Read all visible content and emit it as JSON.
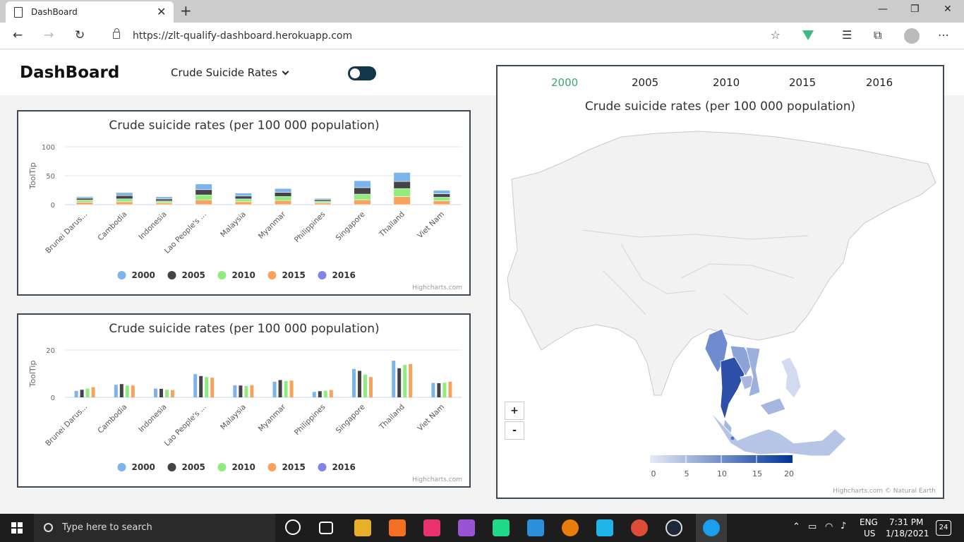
{
  "browser": {
    "tab_title": "DashBoard",
    "url": "https://zlt-qualify-dashboard.herokuapp.com"
  },
  "header": {
    "brand": "DashBoard",
    "dropdown_label": "Crude Suicide Rates"
  },
  "chart_data": [
    {
      "type": "bar",
      "stacked": true,
      "title": "Crude suicide rates (per 100 000 population)",
      "ylabel": "ToolTip",
      "ylim": [
        0,
        100
      ],
      "yticks": [
        0,
        50,
        100
      ],
      "categories": [
        "Brunei Darus...",
        "Cambodia",
        "Indonesia",
        "Lao People's ...",
        "Malaysia",
        "Myanmar",
        "Philippines",
        "Singapore",
        "Thailand",
        "Viet Nam"
      ],
      "series": [
        {
          "name": "2000",
          "color": "#7cb5ec",
          "values": [
            2.7,
            5.3,
            3.7,
            9.8,
            5.1,
            6.6,
            2.3,
            12.0,
            15.5,
            6.1
          ]
        },
        {
          "name": "2005",
          "color": "#434348",
          "values": [
            3.2,
            5.6,
            3.6,
            9.0,
            5.0,
            7.3,
            2.6,
            11.2,
            12.3,
            6.0
          ]
        },
        {
          "name": "2010",
          "color": "#90ed7d",
          "values": [
            3.7,
            5.0,
            3.2,
            8.6,
            4.8,
            6.9,
            2.8,
            9.6,
            13.7,
            6.2
          ]
        },
        {
          "name": "2015",
          "color": "#f7a35c",
          "values": [
            4.3,
            5.0,
            3.1,
            8.3,
            5.1,
            7.1,
            3.1,
            8.6,
            14.1,
            6.6
          ]
        },
        {
          "name": "2016",
          "color": "#8085e9",
          "values": [
            0,
            0,
            0,
            0,
            0,
            0,
            0,
            0,
            0,
            0
          ]
        }
      ],
      "legend_position": "bottom",
      "credit": "Highcharts.com"
    },
    {
      "type": "bar",
      "stacked": false,
      "title": "Crude suicide rates (per 100 000 population)",
      "ylabel": "ToolTip",
      "ylim": [
        0,
        20
      ],
      "yticks": [
        0,
        20
      ],
      "categories": [
        "Brunei Darus...",
        "Cambodia",
        "Indonesia",
        "Lao People's ...",
        "Malaysia",
        "Myanmar",
        "Philippines",
        "Singapore",
        "Thailand",
        "Viet Nam"
      ],
      "series": [
        {
          "name": "2000",
          "color": "#7cb5ec",
          "values": [
            2.7,
            5.3,
            3.7,
            9.8,
            5.1,
            6.6,
            2.3,
            12.0,
            15.5,
            6.1
          ]
        },
        {
          "name": "2005",
          "color": "#434348",
          "values": [
            3.2,
            5.6,
            3.6,
            9.0,
            5.0,
            7.3,
            2.6,
            11.2,
            12.3,
            6.0
          ]
        },
        {
          "name": "2010",
          "color": "#90ed7d",
          "values": [
            3.7,
            5.0,
            3.2,
            8.6,
            4.8,
            6.9,
            2.8,
            9.6,
            13.7,
            6.2
          ]
        },
        {
          "name": "2015",
          "color": "#f7a35c",
          "values": [
            4.3,
            5.0,
            3.1,
            8.3,
            5.1,
            7.1,
            3.1,
            8.6,
            14.1,
            6.6
          ]
        },
        {
          "name": "2016",
          "color": "#8085e9",
          "values": [
            0,
            0,
            0,
            0,
            0,
            0,
            0,
            0,
            0,
            0
          ]
        }
      ],
      "legend_position": "bottom",
      "credit": "Highcharts.com"
    }
  ],
  "map": {
    "years": [
      "2000",
      "2005",
      "2010",
      "2015",
      "2016"
    ],
    "active_year": "2000",
    "title": "Crude suicide rates (per 100 000 population)",
    "zoom_in": "+",
    "zoom_out": "-",
    "colorbar_ticks": [
      "0",
      "5",
      "10",
      "15",
      "20"
    ],
    "color_min": "#e6ebf5",
    "color_max": "#003399",
    "credit": "Highcharts.com © Natural Earth"
  },
  "taskbar": {
    "search_placeholder": "Type here to search",
    "lang": "ENG",
    "region": "US",
    "time": "7:31 PM",
    "date": "1/18/2021",
    "notifications": "24"
  }
}
